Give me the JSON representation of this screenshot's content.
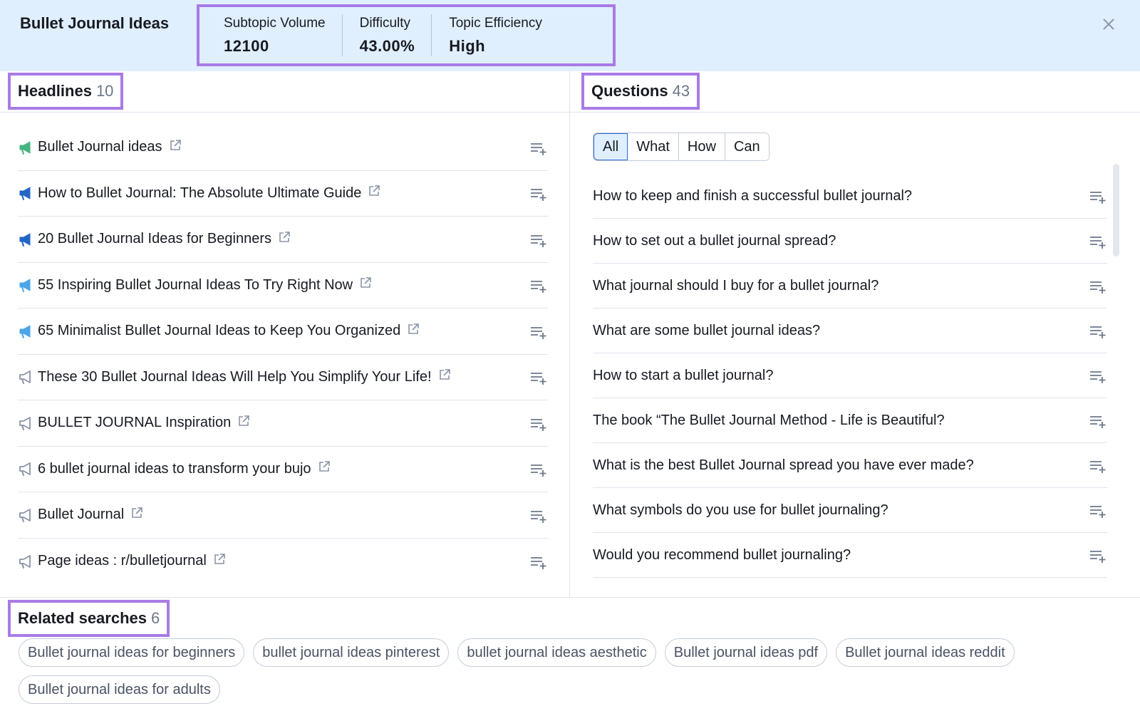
{
  "header": {
    "title": "Bullet Journal Ideas",
    "metrics": [
      {
        "label": "Subtopic Volume",
        "value": "12100"
      },
      {
        "label": "Difficulty",
        "value": "43.00%"
      },
      {
        "label": "Topic Efficiency",
        "value": "High"
      }
    ]
  },
  "headlines": {
    "title": "Headlines",
    "count": "10",
    "items": [
      {
        "text": "Bullet Journal ideas",
        "icon": "megaphone-icon",
        "color": "#45b582"
      },
      {
        "text": "How to Bullet Journal: The Absolute Ultimate Guide",
        "icon": "megaphone-icon",
        "color": "#2166c6"
      },
      {
        "text": "20 Bullet Journal Ideas for Beginners",
        "icon": "megaphone-icon",
        "color": "#2166c6"
      },
      {
        "text": "55 Inspiring Bullet Journal Ideas To Try Right Now",
        "icon": "megaphone-icon",
        "color": "#4aa6e8"
      },
      {
        "text": "65 Minimalist Bullet Journal Ideas to Keep You Organized",
        "icon": "megaphone-icon",
        "color": "#4aa6e8"
      },
      {
        "text": "These 30 Bullet Journal Ideas Will Help You Simplify Your Life!",
        "icon": "megaphone-outline-icon",
        "color": "#8a94a6"
      },
      {
        "text": "BULLET JOURNAL Inspiration",
        "icon": "megaphone-outline-icon",
        "color": "#8a94a6"
      },
      {
        "text": "6 bullet journal ideas to transform your bujo",
        "icon": "megaphone-outline-icon",
        "color": "#8a94a6"
      },
      {
        "text": "Bullet Journal",
        "icon": "megaphone-outline-icon",
        "color": "#8a94a6"
      },
      {
        "text": "Page ideas : r/bulletjournal",
        "icon": "megaphone-outline-icon",
        "color": "#8a94a6"
      }
    ]
  },
  "questions": {
    "title": "Questions",
    "count": "43",
    "filters": [
      "All",
      "What",
      "How",
      "Can"
    ],
    "active_filter": "All",
    "items": [
      "How to keep and finish a successful bullet journal?",
      "How to set out a bullet journal spread?",
      "What journal should I buy for a bullet journal?",
      "What are some bullet journal ideas?",
      "How to start a bullet journal?",
      "The book “The Bullet Journal Method - Life is Beautiful?",
      "What is the best Bullet Journal spread you have ever made?",
      "What symbols do you use for bullet journaling?",
      "Would you recommend bullet journaling?"
    ]
  },
  "related": {
    "title": "Related searches",
    "count": "6",
    "items": [
      "Bullet journal ideas for beginners",
      "bullet journal ideas pinterest",
      "bullet journal ideas aesthetic",
      "Bullet journal ideas pdf",
      "Bullet journal ideas reddit",
      "Bullet journal ideas for adults"
    ]
  },
  "colors": {
    "highlight_border": "#a97be6",
    "header_bg": "#e0effd"
  }
}
